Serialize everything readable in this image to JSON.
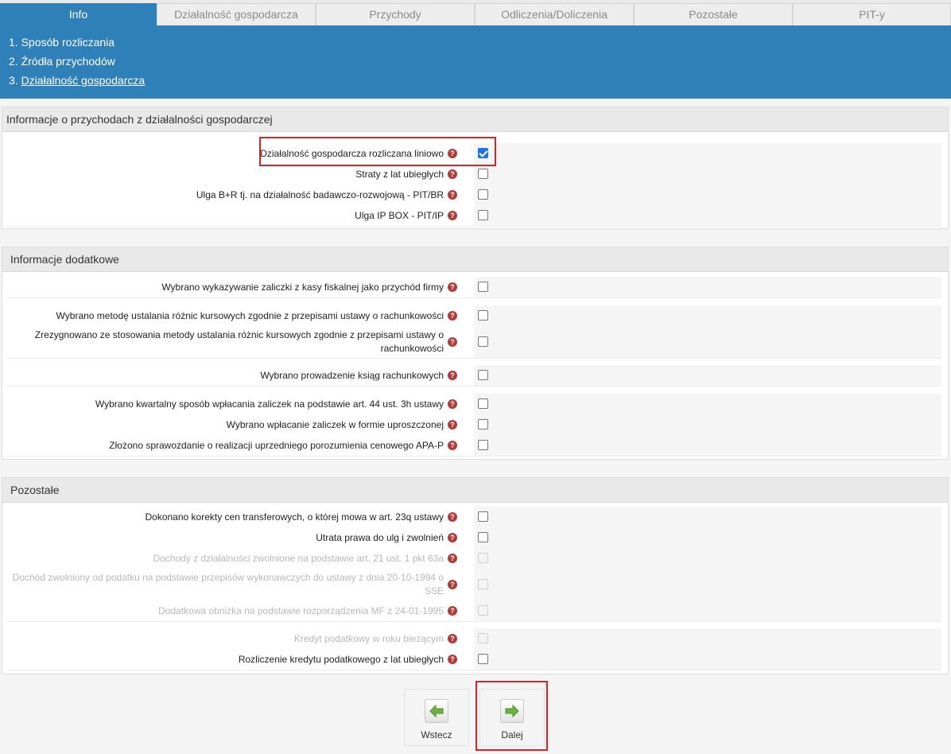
{
  "tabs": [
    {
      "label": "Info",
      "active": true
    },
    {
      "label": "Działalność gospodarcza"
    },
    {
      "label": "Przychody"
    },
    {
      "label": "Odliczenia/Doliczenia"
    },
    {
      "label": "Pozostałe"
    },
    {
      "label": "PIT-y"
    }
  ],
  "steps": [
    {
      "label": "1. Sposób rozliczania"
    },
    {
      "label": "2. Źródła przychodów"
    },
    {
      "label": "3. ",
      "link": "Działalność gospodarcza"
    }
  ],
  "sections": {
    "przychody": {
      "title": "Informacje o przychodach z działalności gospodarczej",
      "rows": [
        {
          "label": "Działalność gospodarcza rozliczana liniowo",
          "checked": true
        },
        {
          "label": "Straty z lat ubiegłych"
        },
        {
          "label": "Ulga B+R tj. na działalność badawczo-rozwojową - PIT/BR"
        },
        {
          "label": "Ulga IP BOX - PIT/IP"
        }
      ]
    },
    "dodatkowe": {
      "title": "Informacje dodatkowe",
      "rows": [
        {
          "label": "Wybrano wykazywanie zaliczki z kasy fiskalnej jako przychód firmy"
        },
        {
          "label": "Wybrano metodę ustalania różnic kursowych zgodnie z przepisami ustawy o rachunkowości"
        },
        {
          "label": "Zrezygnowano ze stosowania metody ustalania różnic kursowych zgodnie z przepisami ustawy o rachunkowości"
        },
        {
          "label": "Wybrano prowadzenie ksiąg rachunkowych"
        },
        {
          "label": "Wybrano kwartalny sposób wpłacania zaliczek na podstawie art. 44 ust. 3h ustawy"
        },
        {
          "label": "Wybrano wpłacanie zaliczek w formie uproszczonej"
        },
        {
          "label": "Złożono sprawozdanie o realizacji uprzedniego porozumienia cenowego APA-P"
        }
      ]
    },
    "pozostale": {
      "title": "Pozostałe",
      "rows": [
        {
          "label": "Dokonano korekty cen transferowych, o której mowa w art. 23q ustawy"
        },
        {
          "label": "Utrata prawa do ulg i zwolnień"
        },
        {
          "label": "Dochody z działalności zwolnione na podstawie art. 21 ust. 1 pkt 63a",
          "disabled": true
        },
        {
          "label": "Dochód zwolniony od podatku na podstawie przepisów wykonawczych do ustawy z dnia 20-10-1994 o SSE",
          "disabled": true
        },
        {
          "label": "Dodatkowa obniżka na podstawie rozporządzenia MF z 24-01-1995",
          "disabled": true
        },
        {
          "label": "Kredyt podatkowy w roku bieżącym",
          "disabled": true
        },
        {
          "label": "Rozliczenie kredytu podatkowego z lat ubiegłych"
        }
      ]
    }
  },
  "help_glyph": "?",
  "buttons": {
    "back": {
      "label": "Wstecz",
      "icon": "arrow-left-icon"
    },
    "next": {
      "label": "Dalej",
      "icon": "arrow-right-icon"
    }
  },
  "colors": {
    "accent": "#2f80b8",
    "highlight": "#d8232a",
    "help": "#b23b3b",
    "arrow": "#6cb33f"
  }
}
